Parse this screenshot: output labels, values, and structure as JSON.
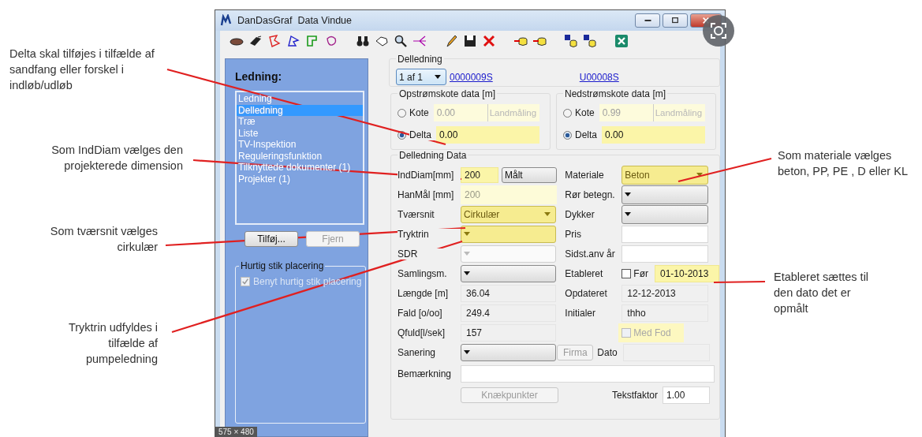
{
  "annotations_left": [
    {
      "lines": [
        "Delta skal tilføjes i tilfælde af",
        "sandfang eller forskel i",
        "indløb/udløb"
      ]
    },
    {
      "lines": [
        "Som IndDiam vælges den",
        "projekterede dimension"
      ]
    },
    {
      "lines": [
        "Som tværsnit vælges",
        "cirkulær"
      ]
    },
    {
      "lines": [
        "Tryktrin udfyldes i",
        "tilfælde af",
        "pumpeledning"
      ]
    }
  ],
  "window": {
    "title": "DanDasGraf  Data Vindue"
  },
  "sidebar": {
    "heading": "Ledning:",
    "items": [
      {
        "label": "Ledning",
        "selected": false
      },
      {
        "label": "Delledning",
        "selected": true
      },
      {
        "label": "Træ",
        "selected": false
      },
      {
        "label": "Liste",
        "selected": false
      },
      {
        "label": "TV-Inspektion",
        "selected": false
      },
      {
        "label": "Reguleringsfunktion",
        "selected": false
      },
      {
        "label": "Tilknyttede dokumenter (1)",
        "selected": false
      },
      {
        "label": "Projekter (1)",
        "selected": false
      }
    ],
    "buttons": [
      {
        "label": "Tilføj...",
        "disabled": false
      },
      {
        "label": "Fjern",
        "disabled": true
      }
    ],
    "quick": {
      "title": "Hurtig stik placering",
      "label": "Benyt hurtig stik placering",
      "checked": true,
      "disabled": true
    }
  },
  "delledning": {
    "title": "Delledning",
    "selector": "1 af 1",
    "links": [
      "0000009S",
      "U00008S"
    ]
  },
  "elevation": [
    {
      "title": "Opstrømskote data [m]",
      "options": [
        {
          "label": "Kote",
          "selected": false,
          "value": "0.00",
          "button": "Landmåling"
        },
        {
          "label": "Delta",
          "selected": true,
          "value": "0.00"
        }
      ]
    },
    {
      "title": "Nedstrømskote data [m]",
      "options": [
        {
          "label": "Kote",
          "selected": false,
          "value": "0.99",
          "button": "Landmåling"
        },
        {
          "label": "Delta",
          "selected": true,
          "value": "0.00"
        }
      ]
    }
  ],
  "data": {
    "title": "Delledning Data",
    "left": [
      {
        "label": "IndDiam[mm]",
        "kind": "input",
        "value": "200",
        "highlighted": true,
        "disabled": false,
        "button": "Målt"
      },
      {
        "label": "HanMål [mm]",
        "kind": "input",
        "value": "200",
        "highlighted": true,
        "disabled": true
      },
      {
        "label": "Tværsnit",
        "kind": "select",
        "value": "Cirkulær",
        "highlighted": true,
        "disabled": false
      },
      {
        "label": "Tryktrin",
        "kind": "select",
        "highlighted": true,
        "disabled": false
      },
      {
        "label": "SDR",
        "kind": "select",
        "highlighted": false,
        "disabled": true
      },
      {
        "label": "Samlingsm.",
        "kind": "select",
        "highlighted": false,
        "disabled": false
      },
      {
        "label": "Længde [m]",
        "kind": "readonly",
        "value": "36.04"
      },
      {
        "label": "Fald [o/oo]",
        "kind": "readonly",
        "value": "249.4"
      },
      {
        "label": "Qfuld[l/sek]",
        "kind": "readonly",
        "value": "157"
      },
      {
        "label": "Sanering",
        "kind": "select",
        "highlighted": false,
        "disabled": false
      }
    ],
    "right": [
      {
        "label": "Materiale",
        "kind": "select",
        "value": "Beton",
        "highlighted": true,
        "disabled": false
      },
      {
        "label": "Rør betegn.",
        "kind": "select",
        "highlighted": false,
        "disabled": false
      },
      {
        "label": "Dykker",
        "kind": "select",
        "highlighted": false,
        "disabled": false
      },
      {
        "label": "Pris",
        "kind": "input",
        "highlighted": false,
        "disabled": false
      },
      {
        "label": "Sidst.anv år",
        "kind": "input",
        "highlighted": false,
        "disabled": false
      },
      {
        "label": "Etableret",
        "kind": "date",
        "check_label": "Før",
        "checked": false,
        "value": "01-10-2013",
        "highlighted": true
      },
      {
        "label": "Opdateret",
        "kind": "readonly",
        "value": "12-12-2013"
      },
      {
        "label": "Initialer",
        "kind": "readonly",
        "value": "thho"
      },
      {
        "kind": "checkbox",
        "check_label": "Med Fod",
        "checked": false,
        "disabled": true,
        "highlighted": true
      },
      {
        "kind": "firma",
        "button": "Firma",
        "button_disabled": true,
        "label": "Dato"
      }
    ],
    "remark": {
      "label": "Bemærkning"
    },
    "bend_button": {
      "label": "Knækpunkter",
      "disabled": true
    },
    "text_factor": {
      "label": "Tekstfaktor",
      "value": "1.00"
    }
  },
  "size_badge": "575 × 480",
  "annotations_right": [
    {
      "lines": [
        "Som materiale vælges",
        "beton, PP, PE , D eller KL"
      ]
    },
    {
      "lines": [
        "Etableret sættes til",
        "den dato det er",
        "opmålt"
      ]
    }
  ]
}
